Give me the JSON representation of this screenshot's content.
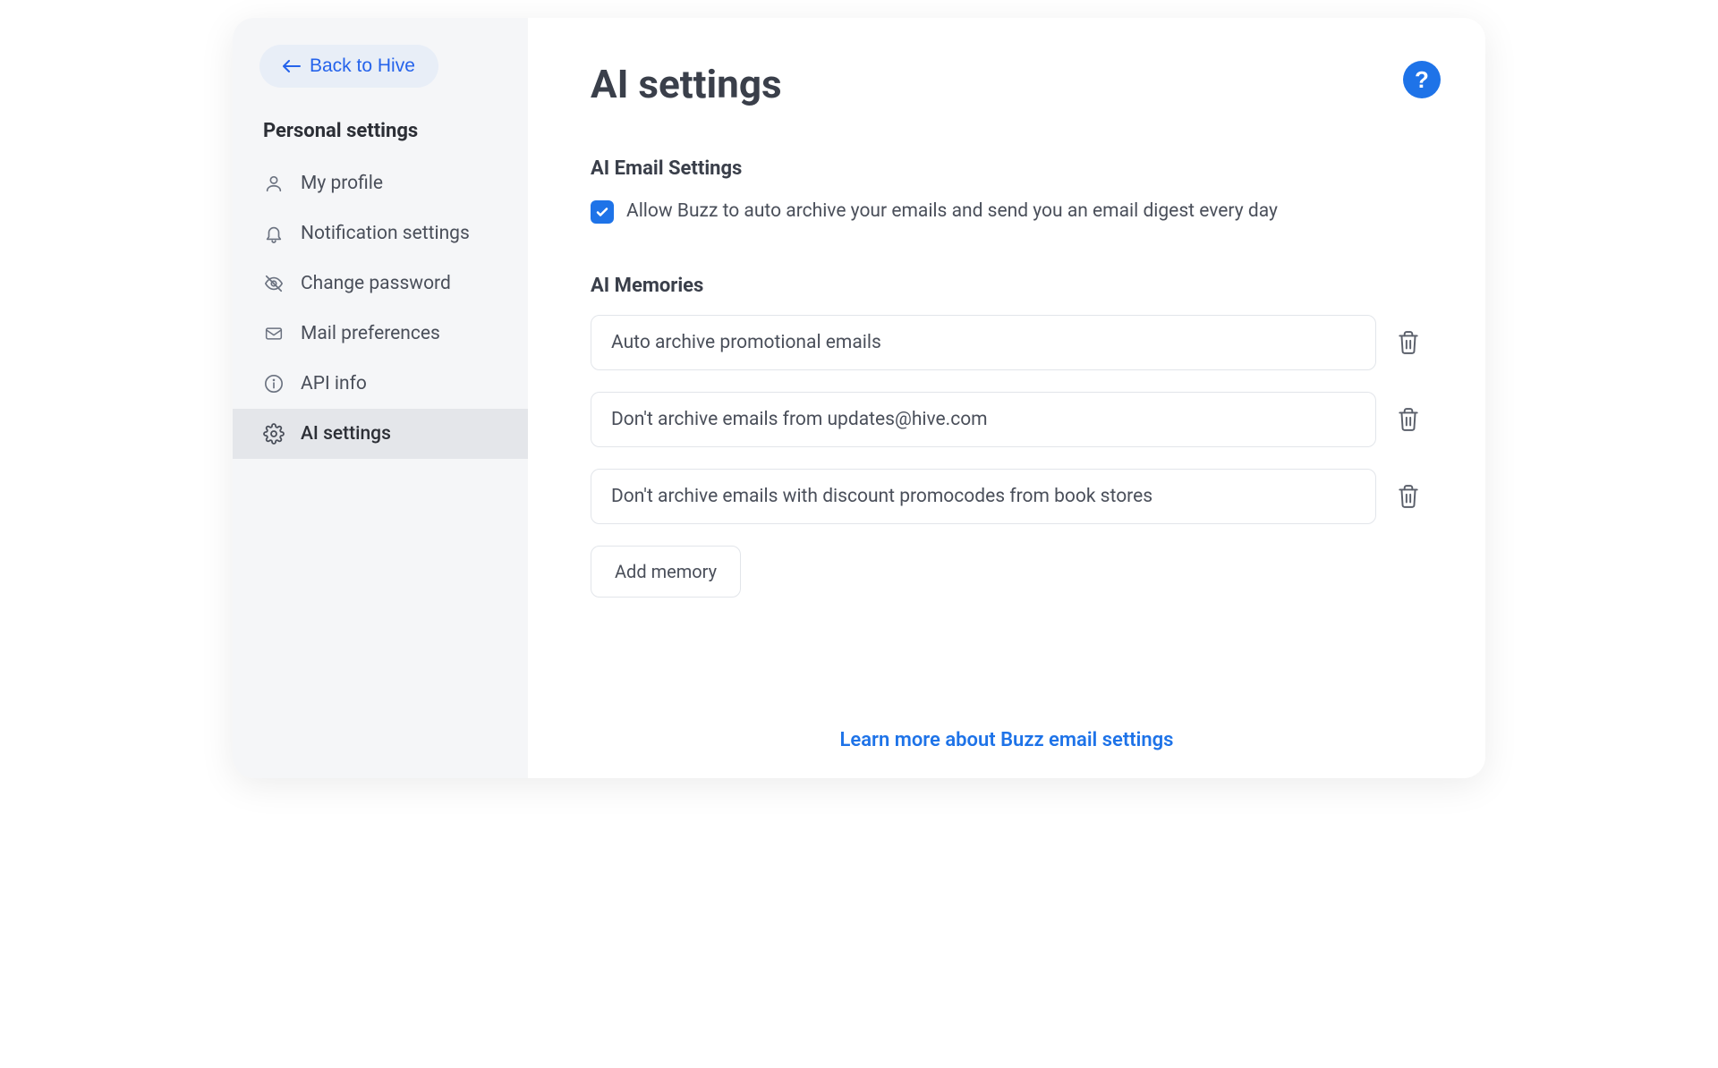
{
  "sidebar": {
    "back_label": "Back to Hive",
    "section_header": "Personal settings",
    "items": [
      {
        "label": "My profile",
        "icon": "user-icon",
        "active": false
      },
      {
        "label": "Notification settings",
        "icon": "bell-icon",
        "active": false
      },
      {
        "label": "Change password",
        "icon": "eye-off-icon",
        "active": false
      },
      {
        "label": "Mail preferences",
        "icon": "mail-icon",
        "active": false
      },
      {
        "label": "API info",
        "icon": "info-icon",
        "active": false
      },
      {
        "label": "AI settings",
        "icon": "gear-icon",
        "active": true
      }
    ]
  },
  "header": {
    "title": "AI settings",
    "help_label": "?"
  },
  "email_settings": {
    "section_title": "AI Email Settings",
    "auto_archive": {
      "checked": true,
      "label": "Allow Buzz to auto archive your emails and send you an email digest every day"
    }
  },
  "memories": {
    "section_title": "AI Memories",
    "items": [
      {
        "text": "Auto archive promotional emails"
      },
      {
        "text": "Don't archive emails from updates@hive.com"
      },
      {
        "text": "Don't archive emails with discount promocodes from book stores"
      }
    ],
    "add_button": "Add memory"
  },
  "footer": {
    "link_label": "Learn more about Buzz email settings"
  },
  "colors": {
    "accent": "#1e73e8",
    "sidebar_bg": "#f5f6f8",
    "text_primary": "#3a3f4a",
    "text_secondary": "#4a4f5a"
  }
}
